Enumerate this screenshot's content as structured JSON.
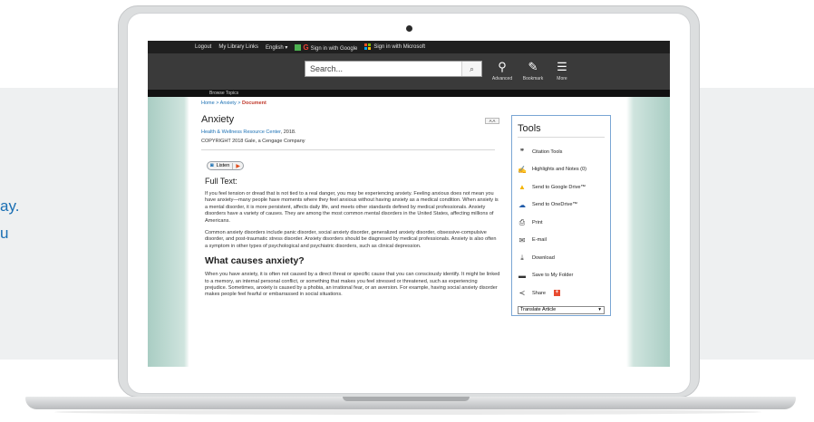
{
  "backdrop": {
    "text_line_1": "ay.",
    "text_line_2": "u"
  },
  "topbar": {
    "logout": "Logout",
    "my_library_links": "My Library Links",
    "language": "English ▾",
    "google_signin": "Sign in with Google",
    "microsoft_signin": "Sign in with Microsoft"
  },
  "header": {
    "search_placeholder": "Search...",
    "advanced_label": "Advanced",
    "bookmark_label": "Bookmark",
    "more_label": "More"
  },
  "browse_topics": "Browse Topics",
  "breadcrumb": {
    "home": "Home",
    "anxiety": "Anxiety",
    "current": "Document",
    "separator": ">"
  },
  "document": {
    "title": "Anxiety",
    "source_link": "Health & Wellness Resource Center",
    "source_year": ", 2018.",
    "copyright": "COPYRIGHT 2018 Gale, a Cengage Company",
    "listen_label": "Listen",
    "full_text_heading": "Full Text:",
    "paragraph_1": "If you feel tension or dread that is not tied to a real danger, you may be experiencing anxiety. Feeling anxious does not mean you have anxiety—many people have moments where they feel anxious without having anxiety as a medical condition. When anxiety is a mental disorder, it is more persistent, affects daily life, and meets other standards defined by medical professionals. Anxiety disorders have a variety of causes. They are among the most common mental disorders in the United States, affecting millions of Americans.",
    "paragraph_2": "Common anxiety disorders include panic disorder, social anxiety disorder, generalized anxiety disorder, obsessive-compulsive disorder, and post-traumatic stress disorder. Anxiety disorders should be diagnosed by medical professionals. Anxiety is also often a symptom in other types of psychological and psychiatric disorders, such as clinical depression.",
    "heading_2": "What causes anxiety?",
    "paragraph_3": "When you have anxiety, it is often not caused by a direct threat or specific cause that you can consciously identify. It might be linked to a memory, an internal personal conflict, or something that makes you feel stressed or threatened, such as experiencing prejudice. Sometimes, anxiety is caused by a phobia, an irrational fear, or an aversion. For example, having social anxiety disorder makes people feel fearful or embarrassed in social situations.",
    "font_size_control": "A A"
  },
  "tools": {
    "title": "Tools",
    "items": [
      {
        "label": "Citation Tools",
        "icon": "quote-icon"
      },
      {
        "label": "Highlights and Notes (0)",
        "icon": "highlighter-icon"
      },
      {
        "label": "Send to Google Drive™",
        "icon": "google-drive-icon"
      },
      {
        "label": "Send to OneDrive™",
        "icon": "onedrive-icon"
      },
      {
        "label": "Print",
        "icon": "print-icon"
      },
      {
        "label": "E-mail",
        "icon": "email-icon"
      },
      {
        "label": "Download",
        "icon": "download-icon"
      },
      {
        "label": "Save to My Folder",
        "icon": "folder-icon"
      },
      {
        "label": "Share",
        "icon": "share-icon"
      }
    ],
    "translate_label": "Translate Article"
  }
}
